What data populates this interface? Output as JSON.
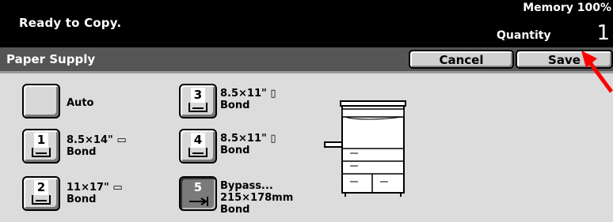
{
  "status": {
    "message": "Ready to Copy.",
    "memory": "Memory 100%",
    "quantity_label": "Quantity",
    "quantity_value": "1"
  },
  "header": {
    "title": "Paper Supply",
    "cancel_label": "Cancel",
    "save_label": "Save"
  },
  "trays": [
    {
      "number": "",
      "label_line1": "Auto",
      "label_line2": "",
      "label_line3": "",
      "selected": false
    },
    {
      "number": "1",
      "label_line1": "8.5×14\"",
      "label_line2": "Bond",
      "label_line3": "",
      "selected": false
    },
    {
      "number": "2",
      "label_line1": "11×17\"",
      "label_line2": "Bond",
      "label_line3": "",
      "selected": false
    },
    {
      "number": "3",
      "label_line1": "8.5×11\"",
      "label_line2": "Bond",
      "label_line3": "",
      "selected": false
    },
    {
      "number": "4",
      "label_line1": "8.5×11\"",
      "label_line2": "Bond",
      "label_line3": "",
      "selected": false
    },
    {
      "number": "5",
      "label_line1": "Bypass...",
      "label_line2": "215×178mm",
      "label_line3": "Bond",
      "selected": true
    }
  ],
  "icons": {
    "copier": "copier-machine-icon",
    "pointer": "red-arrow-pointer-icon"
  },
  "colors": {
    "status_bar": "#000000",
    "header_bar": "#555555",
    "content_bg": "#dcdcdc",
    "pointer": "#ff0000"
  }
}
